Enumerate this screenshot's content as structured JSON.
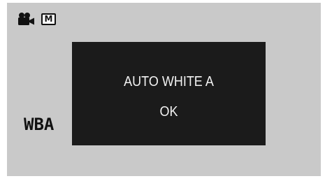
{
  "status_bar": {
    "record_mode_icon": "video-camera-icon",
    "mode_badge": "M"
  },
  "white_balance": {
    "label": "WBA"
  },
  "dialog": {
    "title": "AUTO WHITE A",
    "ok_label": "OK"
  },
  "colors": {
    "background": "#c9c9c9",
    "dialog_background": "#1b1b1b",
    "dialog_text": "#f2f2f2",
    "label_text": "#111111"
  }
}
